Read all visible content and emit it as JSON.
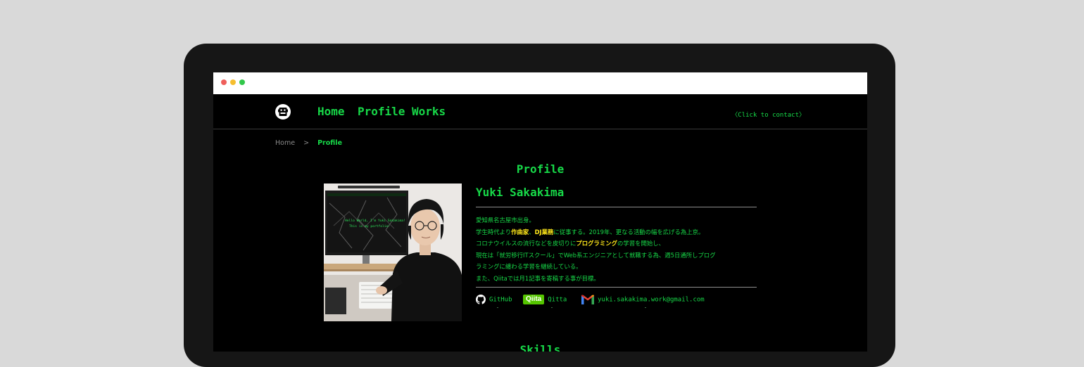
{
  "header": {
    "nav": [
      "Home",
      "Profile",
      "Works"
    ],
    "contact": "〈Click to contact〉"
  },
  "breadcrumb": {
    "home": "Home",
    "separator": ">",
    "current": "Profile"
  },
  "profile": {
    "title": "Profile",
    "name": "Yuki Sakakima",
    "bio": [
      {
        "segments": [
          {
            "text": "愛知県名古屋市出身。"
          }
        ]
      },
      {
        "segments": [
          {
            "text": "学生時代より"
          },
          {
            "text": "作曲家",
            "highlight": true
          },
          {
            "text": "、"
          },
          {
            "text": "DJ業務",
            "highlight": true
          },
          {
            "text": "に従事する。2019年、更なる活動の幅を広げる為上京。"
          }
        ]
      },
      {
        "segments": [
          {
            "text": "コロナウイルスの流行などを皮切りに"
          },
          {
            "text": "プログラミング",
            "highlight": true
          },
          {
            "text": "の学習を開始し、"
          }
        ]
      },
      {
        "segments": [
          {
            "text": "現在は「就労移行ITスクール」でWeb系エンジニアとして就職する為、週5日通所しプログ"
          }
        ]
      },
      {
        "segments": [
          {
            "text": "ラミングに纏わる学習を継続している。"
          }
        ]
      },
      {
        "segments": [
          {
            "text": "また、Qiitaでは月1記事を寄稿する事が目標。"
          }
        ]
      }
    ],
    "links": {
      "github": "GitHub",
      "qiita_badge": "Qiita",
      "qiita": "Qitta",
      "email": "yuki.sakakima.work@gmail.com"
    }
  },
  "skills": {
    "title": "Skills"
  },
  "photo": {
    "monitor_text_line1": "Hello World, I'm Yuki Sakakima!",
    "monitor_text_line2": "This is my portfolio!"
  },
  "colors": {
    "accent": "#17d948",
    "highlight": "#ffe81a",
    "background": "#000000",
    "qiita": "#55c500"
  },
  "icons": [
    "site-logo-icon",
    "github-icon",
    "gmail-icon"
  ]
}
